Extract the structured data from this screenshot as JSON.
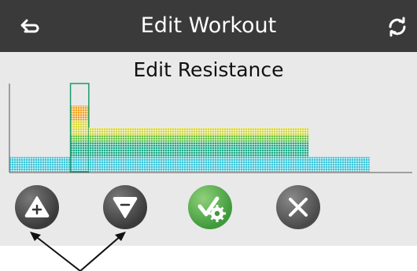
{
  "header": {
    "title": "Edit Workout",
    "back_icon": "back-arrow-icon",
    "refresh_icon": "refresh-icon"
  },
  "main": {
    "subtitle": "Edit Resistance"
  },
  "chart_data": {
    "type": "bar",
    "title": "",
    "segments": [
      {
        "from": 0,
        "to": 10,
        "level": 2
      },
      {
        "from": 10,
        "to": 13,
        "level": 9,
        "selected": true
      },
      {
        "from": 13,
        "to": 49,
        "level": 6
      },
      {
        "from": 49,
        "to": 59,
        "level": 2
      }
    ],
    "x_range": [
      0,
      66
    ],
    "y_range": [
      0,
      12
    ],
    "grid": false
  },
  "controls": {
    "increase_icon": "triangle-up-plus-icon",
    "decrease_icon": "triangle-down-minus-icon",
    "confirm_icon": "check-gear-icon",
    "cancel_icon": "close-x-icon"
  },
  "colors": {
    "header_bg": "#3a3a3a",
    "panel_bg": "#e9e9e9",
    "level_cyan": "#38c3d6",
    "level_teal": "#1faa88",
    "level_green": "#6cc44a",
    "level_yellow": "#d8d83a",
    "level_orange": "#f2a020",
    "selection": "#199a6a",
    "confirm_green": "#3f9a3b"
  }
}
